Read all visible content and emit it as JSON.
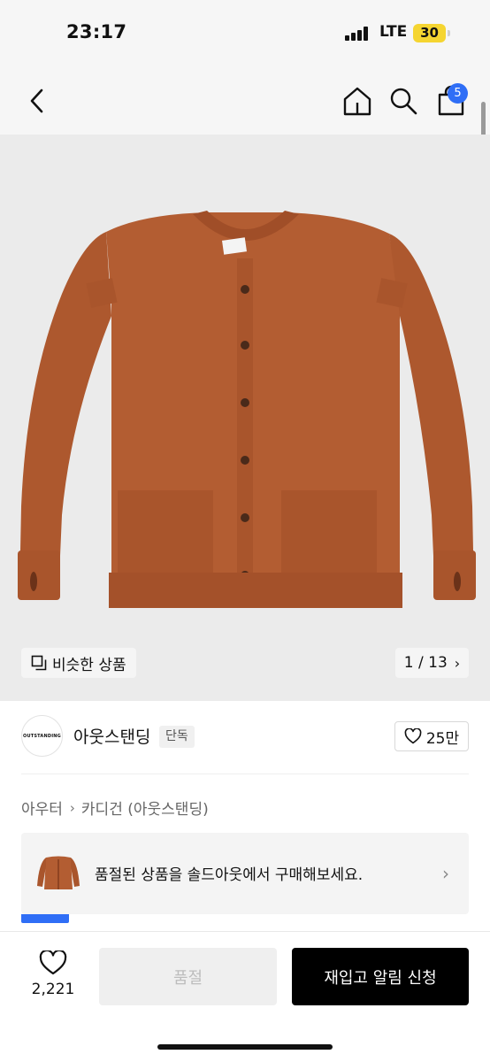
{
  "status_bar": {
    "time": "23:17",
    "network": "LTE",
    "battery": "30"
  },
  "nav": {
    "cart_count": "5"
  },
  "icons": {
    "back": "back-arrow-icon",
    "home": "home-icon",
    "search": "search-icon",
    "cart": "shopping-bag-icon",
    "similar": "similar-items-icon",
    "like": "heart-icon"
  },
  "product": {
    "image_description_color": "#b35d32",
    "similar_label": "비슷한 상품",
    "page_indicator": "1 / 13",
    "page_chevron": "›"
  },
  "brand": {
    "logo_text": "OUTSTANDING",
    "name": "아웃스탠딩",
    "exclusive_label": "단독",
    "likes": "25만"
  },
  "breadcrumb": {
    "category": "아우터",
    "separator": "›",
    "subcategory": "카디건 (아웃스탠딩)"
  },
  "soldout_banner": {
    "text": "품절된 상품을 솔드아웃에서 구매해보세요.",
    "chevron": "›"
  },
  "bottom_bar": {
    "wish_count": "2,221",
    "soldout_label": "품절",
    "restock_label": "재입고 알림 신청"
  },
  "colors": {
    "accent": "#2f6ef6",
    "battery": "#f5d531",
    "primary_button": "#000000",
    "disabled_button": "#efefef"
  }
}
